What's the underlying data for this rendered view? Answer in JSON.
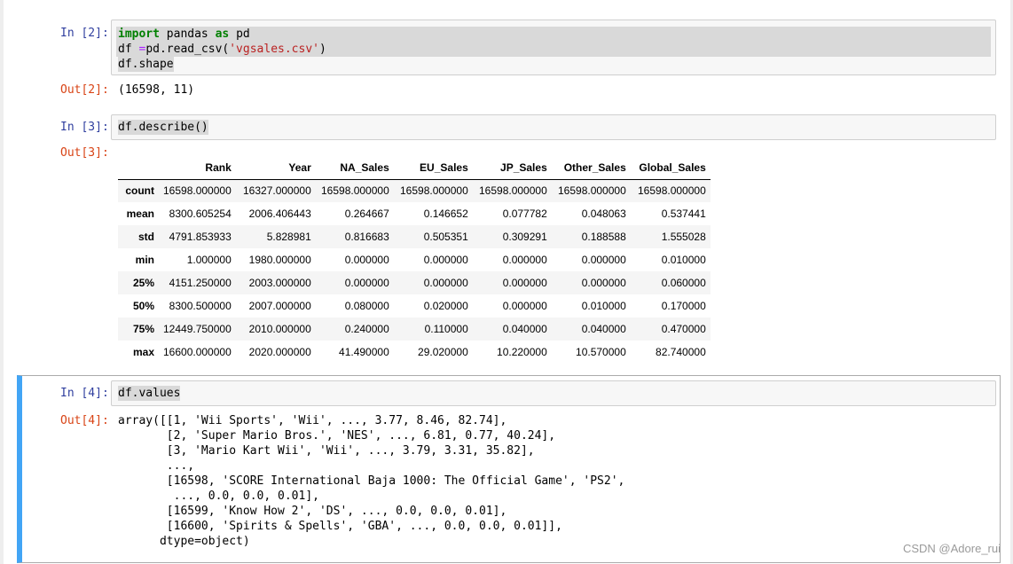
{
  "cells": {
    "c2": {
      "in_prompt": "In [2]:",
      "out_prompt": "Out[2]:",
      "code_lines": {
        "l1_kw1": "import",
        "l1_mod": " pandas ",
        "l1_kw2": "as",
        "l1_alias": " pd",
        "l2_a": "df ",
        "l2_op": "=",
        "l2_b": "pd.read_csv(",
        "l2_str": "'vgsales.csv'",
        "l2_c": ")",
        "l3": "df.shape"
      },
      "output": "(16598, 11)"
    },
    "c3": {
      "in_prompt": "In [3]:",
      "out_prompt": "Out[3]:",
      "code": "df.describe()",
      "table": {
        "columns": [
          "Rank",
          "Year",
          "NA_Sales",
          "EU_Sales",
          "JP_Sales",
          "Other_Sales",
          "Global_Sales"
        ],
        "rows": [
          {
            "index": "count",
            "values": [
              "16598.000000",
              "16327.000000",
              "16598.000000",
              "16598.000000",
              "16598.000000",
              "16598.000000",
              "16598.000000"
            ]
          },
          {
            "index": "mean",
            "values": [
              "8300.605254",
              "2006.406443",
              "0.264667",
              "0.146652",
              "0.077782",
              "0.048063",
              "0.537441"
            ]
          },
          {
            "index": "std",
            "values": [
              "4791.853933",
              "5.828981",
              "0.816683",
              "0.505351",
              "0.309291",
              "0.188588",
              "1.555028"
            ]
          },
          {
            "index": "min",
            "values": [
              "1.000000",
              "1980.000000",
              "0.000000",
              "0.000000",
              "0.000000",
              "0.000000",
              "0.010000"
            ]
          },
          {
            "index": "25%",
            "values": [
              "4151.250000",
              "2003.000000",
              "0.000000",
              "0.000000",
              "0.000000",
              "0.000000",
              "0.060000"
            ]
          },
          {
            "index": "50%",
            "values": [
              "8300.500000",
              "2007.000000",
              "0.080000",
              "0.020000",
              "0.000000",
              "0.010000",
              "0.170000"
            ]
          },
          {
            "index": "75%",
            "values": [
              "12449.750000",
              "2010.000000",
              "0.240000",
              "0.110000",
              "0.040000",
              "0.040000",
              "0.470000"
            ]
          },
          {
            "index": "max",
            "values": [
              "16600.000000",
              "2020.000000",
              "41.490000",
              "29.020000",
              "10.220000",
              "10.570000",
              "82.740000"
            ]
          }
        ]
      }
    },
    "c4": {
      "in_prompt": "In [4]:",
      "out_prompt": "Out[4]:",
      "code": "df.values",
      "output_lines": [
        "array([[1, 'Wii Sports', 'Wii', ..., 3.77, 8.46, 82.74],",
        "       [2, 'Super Mario Bros.', 'NES', ..., 6.81, 0.77, 40.24],",
        "       [3, 'Mario Kart Wii', 'Wii', ..., 3.79, 3.31, 35.82],",
        "       ...,",
        "       [16598, 'SCORE International Baja 1000: The Official Game', 'PS2',",
        "        ..., 0.0, 0.0, 0.01],",
        "       [16599, 'Know How 2', 'DS', ..., 0.0, 0.0, 0.01],",
        "       [16600, 'Spirits & Spells', 'GBA', ..., 0.0, 0.0, 0.01]],",
        "      dtype=object)"
      ]
    }
  },
  "watermark": "CSDN @Adore_rui"
}
